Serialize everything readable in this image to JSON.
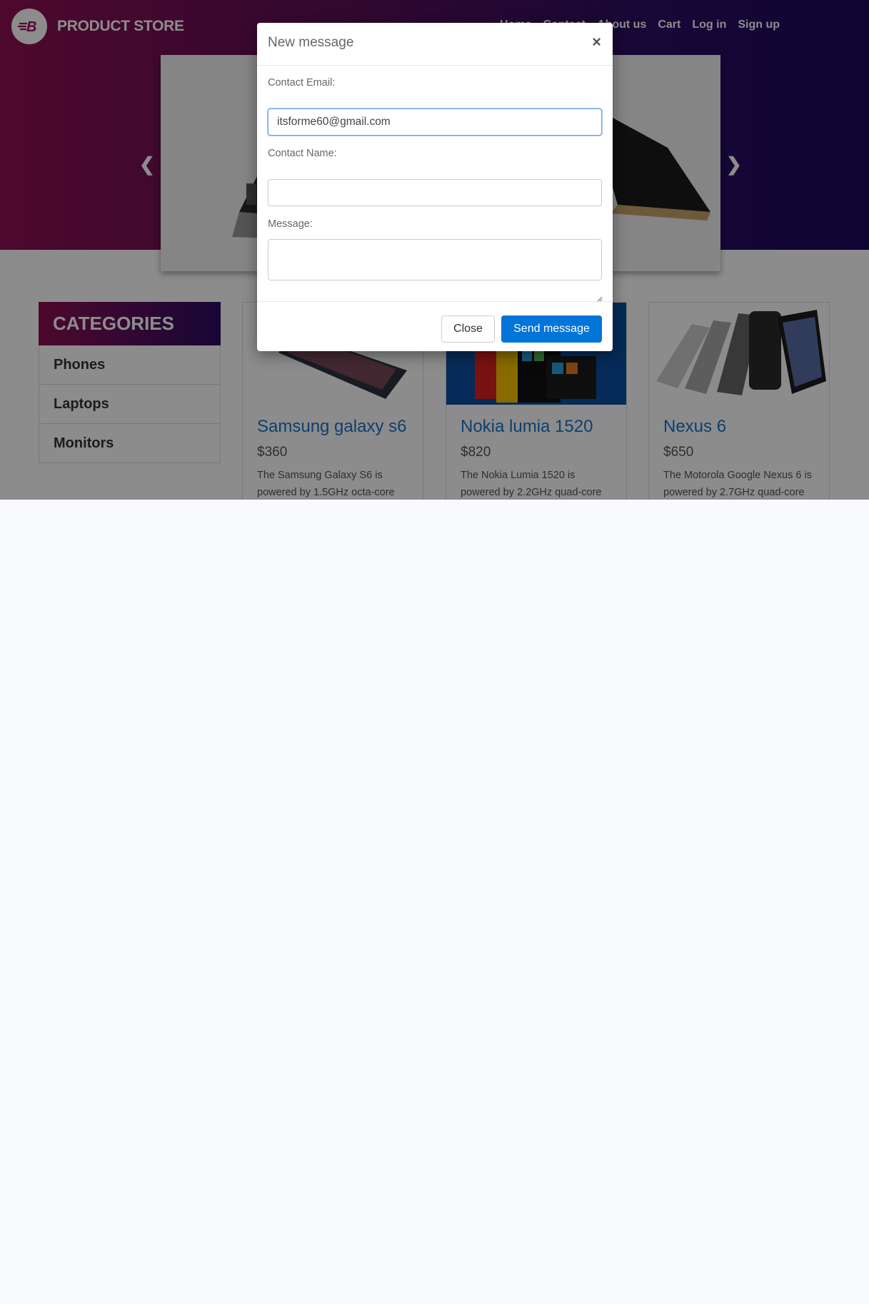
{
  "brand": {
    "name": "PRODUCT STORE",
    "logo_letter": "B"
  },
  "nav": {
    "items": [
      "Home",
      "Contact",
      "About us",
      "Cart",
      "Log in",
      "Sign up"
    ]
  },
  "carousel": {
    "prev_icon": "chevron-left-icon",
    "next_icon": "chevron-right-icon"
  },
  "categories": {
    "heading": "CATEGORIES",
    "items": [
      "Phones",
      "Laptops",
      "Monitors"
    ]
  },
  "products": [
    {
      "title": "Samsung galaxy s6",
      "price": "$360",
      "desc": "The Samsung Galaxy S6 is powered by 1.5GHz octa-core"
    },
    {
      "title": "Nokia lumia 1520",
      "price": "$820",
      "desc": "The Nokia Lumia 1520 is powered by 2.2GHz quad-core"
    },
    {
      "title": "Nexus 6",
      "price": "$650",
      "desc": "The Motorola Google Nexus 6 is powered by 2.7GHz quad-core"
    }
  ],
  "modal": {
    "title": "New message",
    "close_symbol": "×",
    "email_label": "Contact Email:",
    "email_value": "itsforme60@gmail.com",
    "name_label": "Contact Name:",
    "name_value": "",
    "message_label": "Message:",
    "message_value": "",
    "close_button": "Close",
    "send_button": "Send message"
  },
  "colors": {
    "hero_start": "#8e0f52",
    "hero_end": "#1d0a5e",
    "link_blue": "#1a73c9",
    "primary_button": "#0275d8"
  }
}
